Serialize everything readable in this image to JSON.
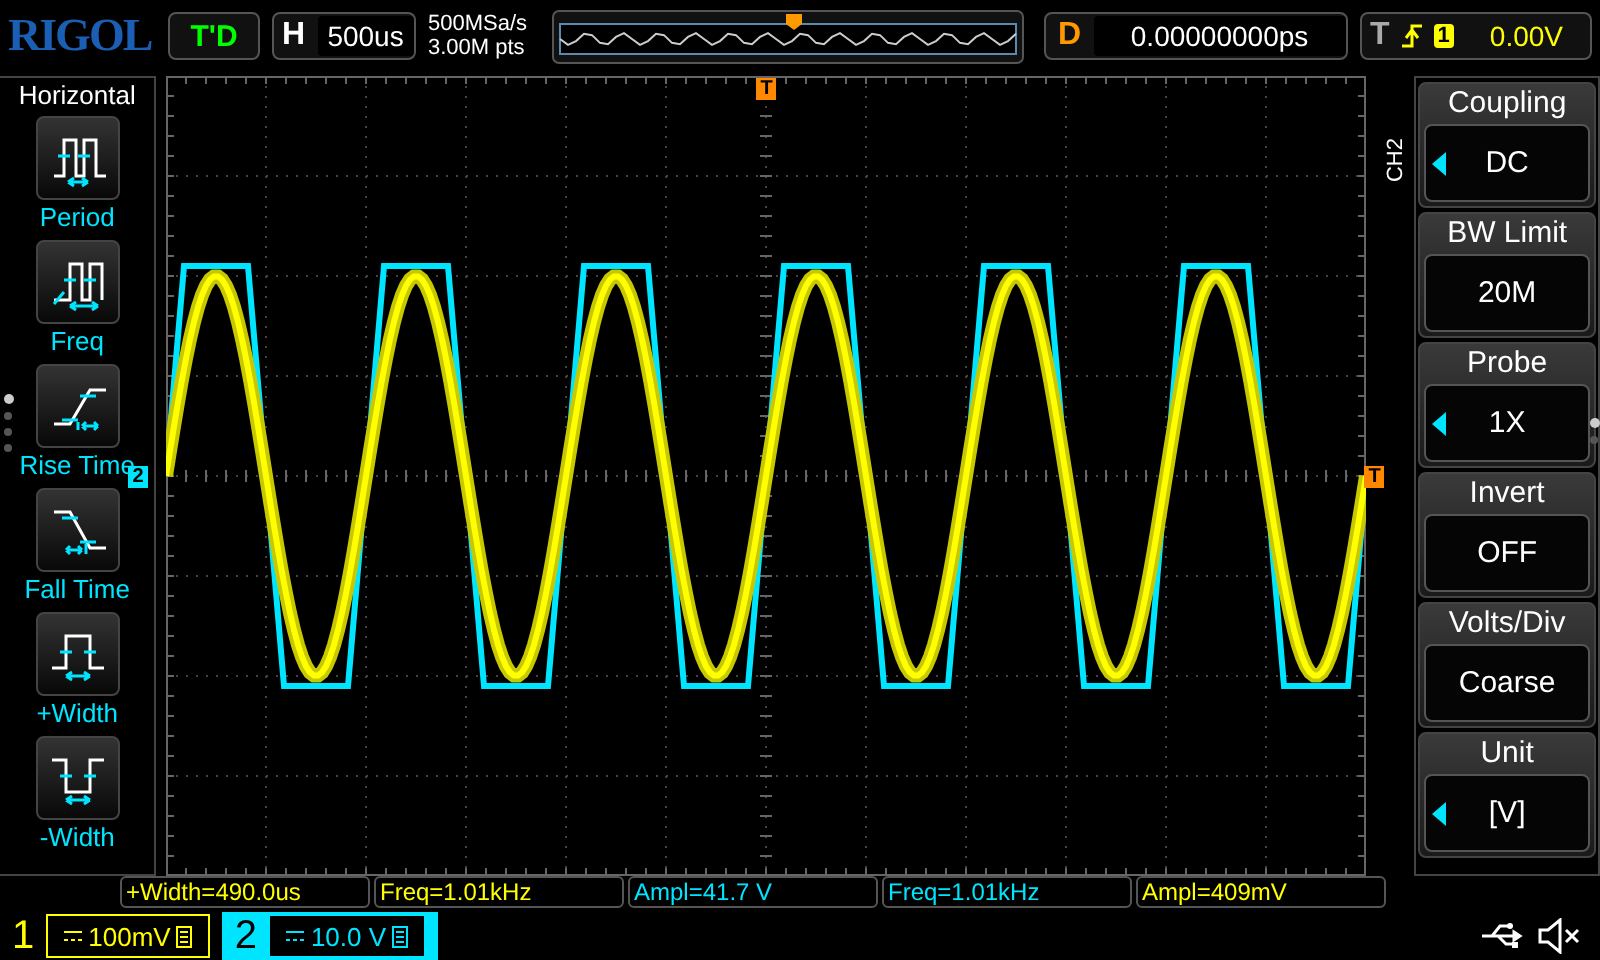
{
  "header": {
    "logo": "RIGOL",
    "run_status": "T'D",
    "horizontal": {
      "label": "H",
      "timebase": "500us"
    },
    "sample_rate": "500MSa/s",
    "memory_depth": "3.00M pts",
    "delay": {
      "label": "D",
      "value": "0.00000000ps"
    },
    "trigger": {
      "label": "T",
      "source": "1",
      "level": "0.00V"
    }
  },
  "left_menu": {
    "title": "Horizontal",
    "items": [
      {
        "kind": "period",
        "label": "Period"
      },
      {
        "kind": "freq",
        "label": "Freq"
      },
      {
        "kind": "rise",
        "label": "Rise Time"
      },
      {
        "kind": "fall",
        "label": "Fall Time"
      },
      {
        "kind": "pwidth",
        "label": "+Width"
      },
      {
        "kind": "nwidth",
        "label": "-Width"
      }
    ]
  },
  "markers": {
    "trigger_position": "T",
    "channel": "2",
    "trigger_level": "T"
  },
  "channel_label": "CH2",
  "right_menu": [
    {
      "title": "Coupling",
      "value": "DC",
      "adjustable": true
    },
    {
      "title": "BW Limit",
      "value": "20M",
      "adjustable": false
    },
    {
      "title": "Probe",
      "value": "1X",
      "adjustable": true
    },
    {
      "title": "Invert",
      "value": "OFF",
      "adjustable": false
    },
    {
      "title": "Volts/Div",
      "value": "Coarse",
      "adjustable": false
    },
    {
      "title": "Unit",
      "value": "[V]",
      "adjustable": true
    }
  ],
  "measurements": [
    {
      "text": "+Width=490.0us",
      "color": "#ffff00"
    },
    {
      "text": "Freq=1.01kHz",
      "color": "#ffff00"
    },
    {
      "text": "Ampl=41.7 V",
      "color": "#00e5ff"
    },
    {
      "text": "Freq=1.01kHz",
      "color": "#00e5ff"
    },
    {
      "text": "Ampl=409mV",
      "color": "#ffff00"
    }
  ],
  "channels": [
    {
      "number": "1",
      "scale": "100mV",
      "color": "#ffff00",
      "selected": false
    },
    {
      "number": "2",
      "scale": "10.0 V",
      "color": "#00e5ff",
      "selected": true
    }
  ]
}
